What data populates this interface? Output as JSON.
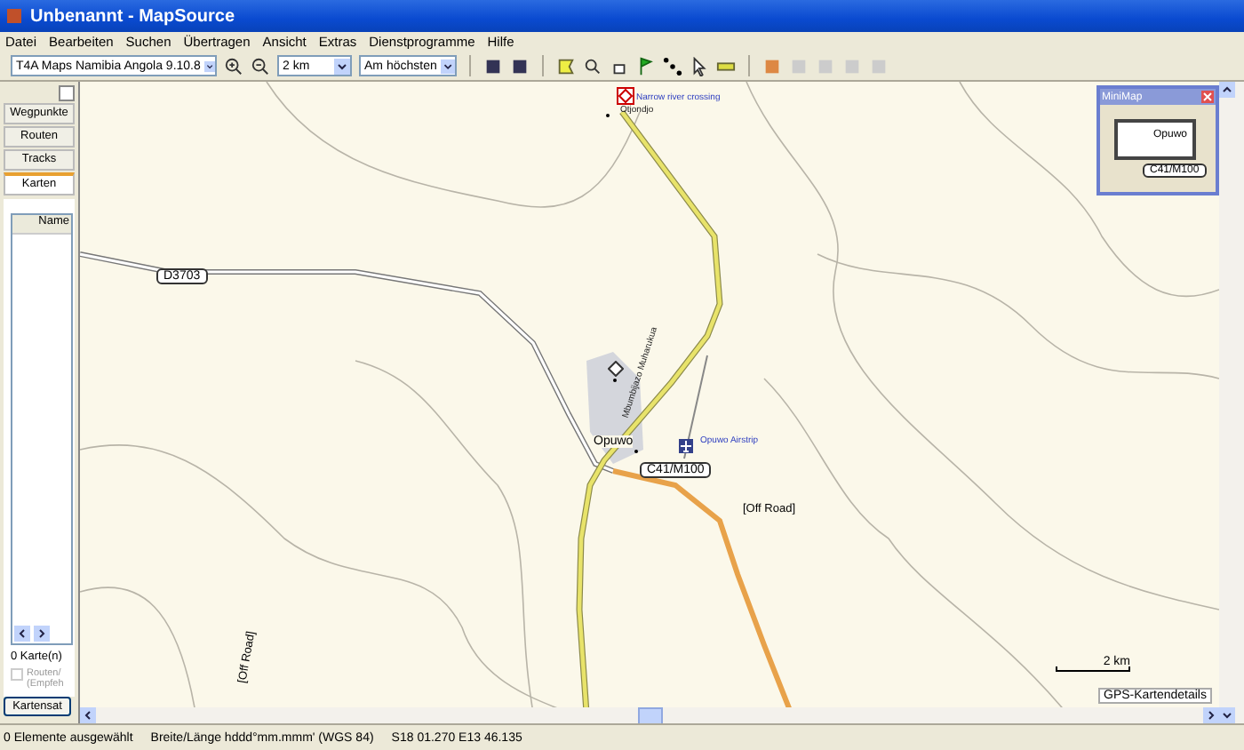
{
  "window": {
    "title": "Unbenannt - MapSource"
  },
  "menu": [
    "Datei",
    "Bearbeiten",
    "Suchen",
    "Übertragen",
    "Ansicht",
    "Extras",
    "Dienstprogramme",
    "Hilfe"
  ],
  "toolbar": {
    "map_product": "T4A Maps Namibia Angola 9.10.8",
    "zoom_scale": "2 km",
    "detail_level": "Am höchsten"
  },
  "sidebar": {
    "tabs": [
      {
        "label": "Wegpunkte",
        "selected": false
      },
      {
        "label": "Routen",
        "selected": false
      },
      {
        "label": "Tracks",
        "selected": false
      },
      {
        "label": "Karten",
        "selected": true
      }
    ],
    "column": "Name",
    "count": "0 Karte(n)",
    "checkbox": {
      "lines": [
        "Routen/",
        "(Empfeh"
      ],
      "checked": false,
      "disabled": true
    },
    "button": "Kartensat"
  },
  "map": {
    "labels": [
      {
        "kind": "poi",
        "text": "Narrow river crossing"
      },
      {
        "kind": "place",
        "text": "Otjondjo"
      },
      {
        "kind": "shield",
        "text": "D3703"
      },
      {
        "kind": "street",
        "text": "Mbumbijazo Muharukua"
      },
      {
        "kind": "town",
        "text": "Opuwo"
      },
      {
        "kind": "poi",
        "text": "Opuwo Airstrip"
      },
      {
        "kind": "shield",
        "text": "C41/M100"
      },
      {
        "kind": "road",
        "text": "[Off Road]"
      },
      {
        "kind": "road",
        "text": "[Off Road]"
      }
    ],
    "scale": "2 km",
    "details_button": "GPS-Kartendetails",
    "minimap": {
      "title": "MiniMap",
      "labels": [
        {
          "kind": "town",
          "text": "Opuwo"
        },
        {
          "kind": "shield",
          "text": "C41/M100"
        }
      ]
    }
  },
  "status_bar": [
    "0 Elemente ausgewählt",
    "Breite/Länge hddd°mm.mmm' (WGS 84)",
    "S18 01.270 E13 46.135"
  ]
}
